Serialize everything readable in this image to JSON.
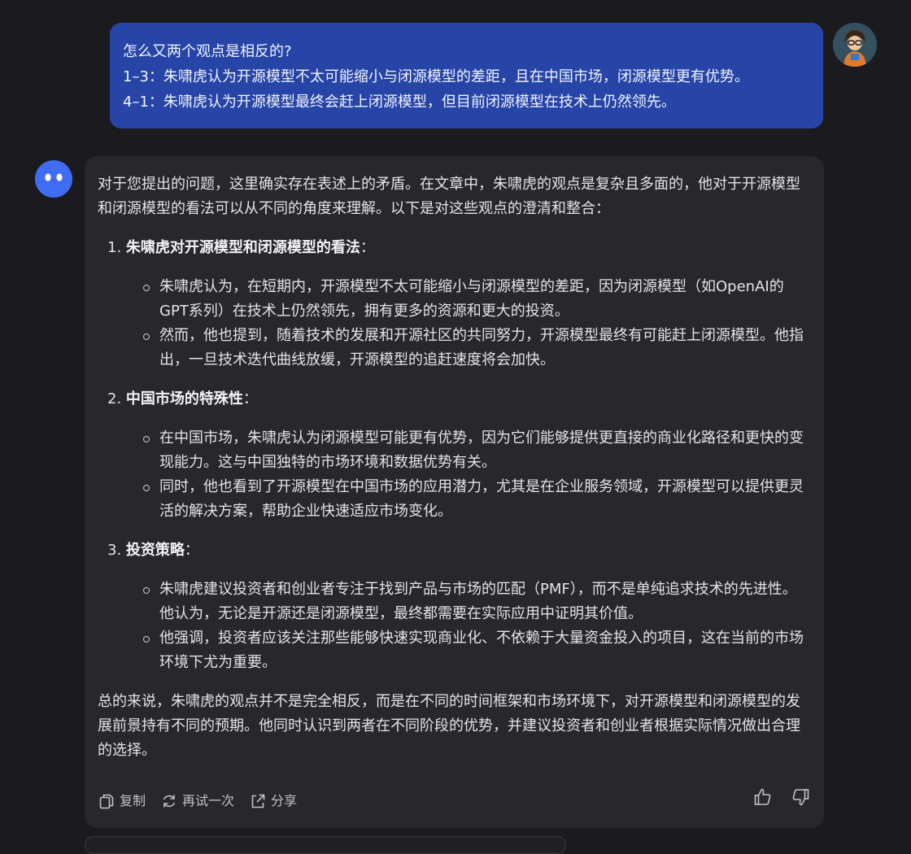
{
  "user_message": {
    "lines": [
      "怎么又两个观点是相反的?",
      "1–3：朱啸虎认为开源模型不太可能缩小与闭源模型的差距，且在中国市场，闭源模型更有优势。",
      "4–1：朱啸虎认为开源模型最终会赶上闭源模型，但目前闭源模型在技术上仍然领先。"
    ]
  },
  "assistant_message": {
    "intro": "对于您提出的问题，这里确实存在表述上的矛盾。在文章中，朱啸虎的观点是复杂且多面的，他对于开源模型和闭源模型的看法可以从不同的角度来理解。以下是对这些观点的澄清和整合：",
    "sections": [
      {
        "number": "1.",
        "title": "朱啸虎对开源模型和闭源模型的看法",
        "suffix": "：",
        "bullets": [
          "朱啸虎认为，在短期内，开源模型不太可能缩小与闭源模型的差距，因为闭源模型（如OpenAI的GPT系列）在技术上仍然领先，拥有更多的资源和更大的投资。",
          "然而，他也提到，随着技术的发展和开源社区的共同努力，开源模型最终有可能赶上闭源模型。他指出，一旦技术迭代曲线放缓，开源模型的追赶速度将会加快。"
        ]
      },
      {
        "number": "2.",
        "title": "中国市场的特殊性",
        "suffix": "：",
        "bullets": [
          "在中国市场，朱啸虎认为闭源模型可能更有优势，因为它们能够提供更直接的商业化路径和更快的变现能力。这与中国独特的市场环境和数据优势有关。",
          "同时，他也看到了开源模型在中国市场的应用潜力，尤其是在企业服务领域，开源模型可以提供更灵活的解决方案，帮助企业快速适应市场变化。"
        ]
      },
      {
        "number": "3.",
        "title": "投资策略",
        "suffix": "：",
        "bullets": [
          "朱啸虎建议投资者和创业者专注于找到产品与市场的匹配（PMF），而不是单纯追求技术的先进性。他认为，无论是开源还是闭源模型，最终都需要在实际应用中证明其价值。",
          "他强调，投资者应该关注那些能够快速实现商业化、不依赖于大量资金投入的项目，这在当前的市场环境下尤为重要。"
        ]
      }
    ],
    "conclusion": "总的来说，朱啸虎的观点并不是完全相反，而是在不同的时间框架和市场环境下，对开源模型和闭源模型的发展前景持有不同的预期。他同时认识到两者在不同阶段的优势，并建议投资者和创业者根据实际情况做出合理的选择。"
  },
  "actions": {
    "copy_label": "复制",
    "copy_icon": "copy-icon",
    "retry_label": "再试一次",
    "retry_icon": "refresh-icon",
    "share_label": "分享",
    "share_icon": "share-icon",
    "like_icon": "thumbs-up-icon",
    "dislike_icon": "thumbs-down-icon"
  },
  "colors": {
    "page_background": "#1b1b1f",
    "user_bubble": "#2645a6",
    "assistant_card": "#27272c",
    "bot_avatar": "#3f6cf2"
  }
}
